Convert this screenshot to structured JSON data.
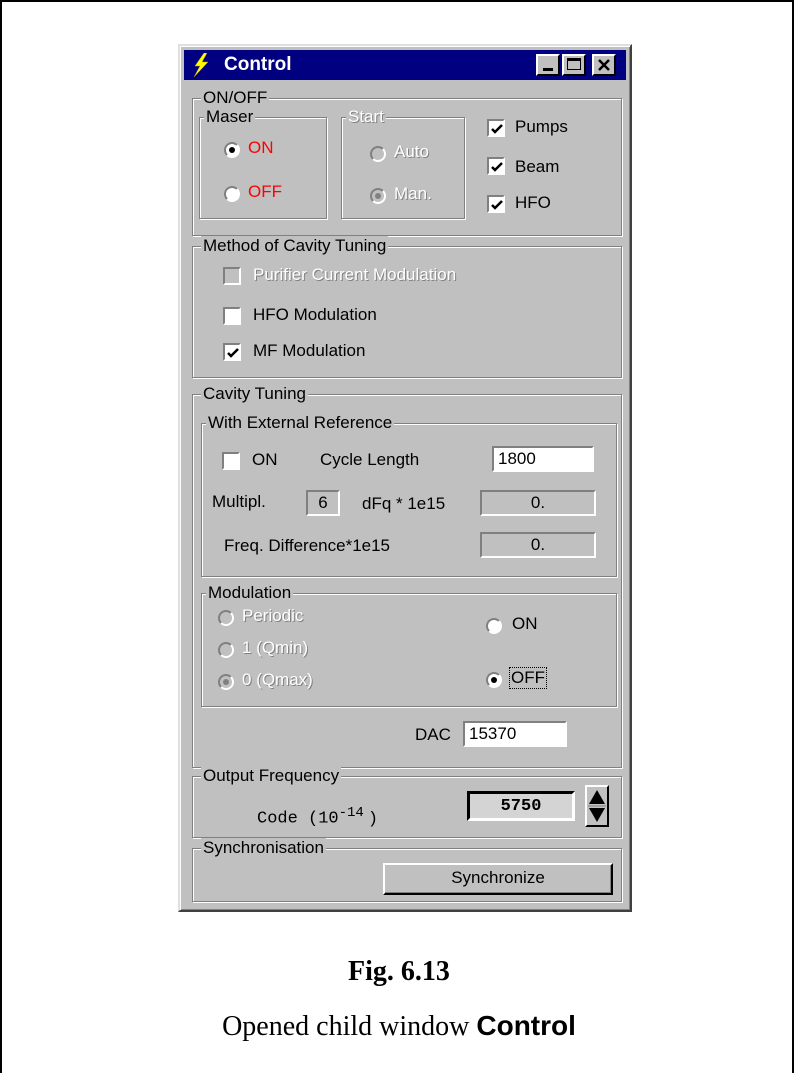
{
  "window": {
    "title": "Control"
  },
  "onoff": {
    "title": "ON/OFF",
    "maser": {
      "title": "Maser",
      "on": "ON",
      "off": "OFF",
      "selected": "ON"
    },
    "start": {
      "title": "Start",
      "auto": "Auto",
      "man": "Man.",
      "selected": "Man."
    },
    "checks": [
      {
        "label": "Pumps",
        "checked": true
      },
      {
        "label": "Beam",
        "checked": true
      },
      {
        "label": "HFO",
        "checked": true
      }
    ]
  },
  "method": {
    "title": "Method of Cavity Tuning",
    "items": [
      {
        "label": "Purifier Current Modulation",
        "checked": false,
        "enabled": false
      },
      {
        "label": "HFO Modulation",
        "checked": false,
        "enabled": true
      },
      {
        "label": "MF Modulation",
        "checked": true,
        "enabled": true
      }
    ]
  },
  "cavity": {
    "title": "Cavity Tuning",
    "external": {
      "title": "With External Reference",
      "on_label": "ON",
      "on_checked": false,
      "cycle_label": "Cycle Length",
      "cycle_value": "1800",
      "multipl_label": "Multipl.",
      "multipl_value": "6",
      "dfq_label": "dFq * 1e15",
      "dfq_value": "0.",
      "freqdiff_label": "Freq. Difference*1e15",
      "freqdiff_value": "0."
    },
    "modulation": {
      "title": "Modulation",
      "periodic": "Periodic",
      "qmin": "1 (Qmin)",
      "qmax": "0 (Qmax)",
      "on": "ON",
      "off": "OFF",
      "mode_selected": "0 (Qmax)",
      "state_selected": "OFF"
    },
    "dac_label": "DAC",
    "dac_value": "15370"
  },
  "output": {
    "title": "Output Frequency",
    "code_label": "Code (10",
    "code_exp": "-14",
    "code_close": ")",
    "value": "5750"
  },
  "sync": {
    "title": "Synchronisation",
    "button": "Synchronize"
  },
  "caption": {
    "fig": "Fig. 6.13",
    "text": "Opened child window",
    "bold": "Control"
  },
  "colors": {
    "titlebar": "#000080",
    "face": "#c0c0c0",
    "red_label": "#ff0000"
  }
}
